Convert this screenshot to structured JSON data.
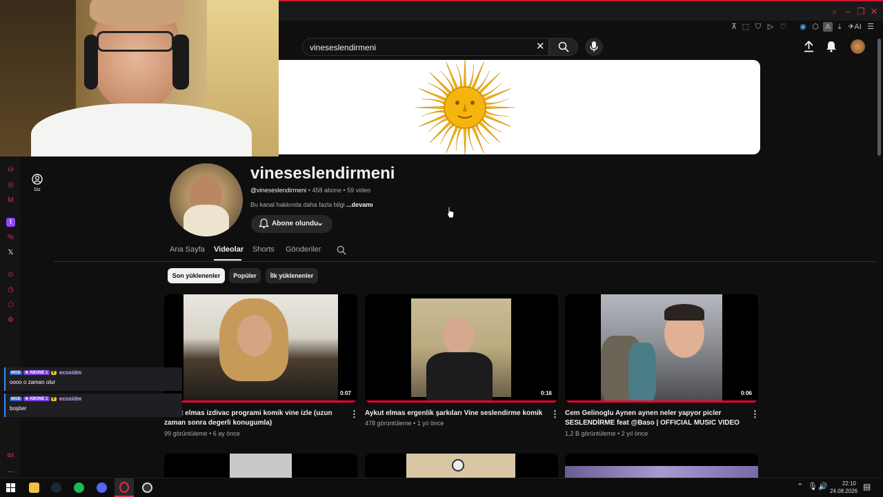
{
  "search": {
    "query": "vineseslendirmeni"
  },
  "channel": {
    "name": "vineseslendirmeni",
    "handle": "@vineseslendirmeni",
    "subscribers": "458 abone",
    "video_count": "59 video",
    "separator": "•",
    "description": "Bu kanal hakkında daha fazla bilgi",
    "more_link": "...devamı",
    "subscribe_label": "Abone olundu"
  },
  "sidebar": {
    "you_label": "Siz"
  },
  "tabs": [
    "Ana Sayfa",
    "Videolar",
    "Shorts",
    "Gönderiler"
  ],
  "chips": [
    "Son yüklenenler",
    "Popüler",
    "İlk yüklenenler"
  ],
  "videos": [
    {
      "title": "Aykut elmas izdivac programi komik vine izle (uzun zaman sonra degerli konugumla)",
      "views": "99 görüntüleme",
      "age": "6 ay önce",
      "duration": "0:07"
    },
    {
      "title": "Aykut elmas ergenlik şarkıları Vine seslendirme komik",
      "views": "478 görüntüleme",
      "age": "1 yıl önce",
      "duration": "0:16"
    },
    {
      "title": "Cem Gelinoglu  Aynen aynen neler yapyor picler SESLENDİRME feat @Baso | OFFICIAL MUSIC VIDEO",
      "views": "1,2 B görüntüleme",
      "age": "2 yıl önce",
      "duration": "0:06"
    }
  ],
  "chat": [
    {
      "badges": [
        "MOD",
        "★ ABONE 1",
        "Y"
      ],
      "user": "ecosidm",
      "message": "oooo o zaman olur"
    },
    {
      "badges": [
        "MOD",
        "★ ABONE 1",
        "Y"
      ],
      "user": "ecosidm",
      "message": "boşber"
    }
  ],
  "taskbar": {
    "time": "22:10",
    "date": "24.08.2026"
  },
  "browser": {
    "ai_label": "AI"
  },
  "colors": {
    "accent": "#ff0033",
    "browser_red": "#e0304a",
    "background": "#0f0f0f"
  }
}
